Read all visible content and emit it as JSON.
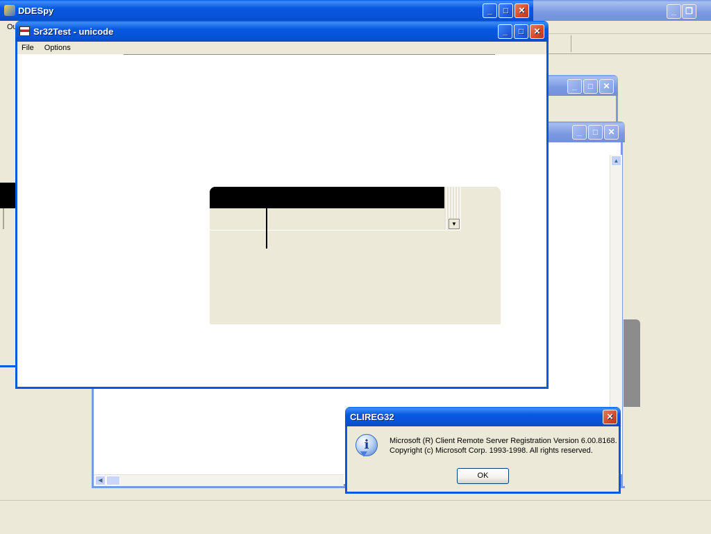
{
  "ddespy": {
    "title": "DDESpy",
    "menu_stub": "Ou"
  },
  "bg_window_right": {
    "title": ""
  },
  "sr32": {
    "title": "Sr32Test - unicode",
    "menu": [
      "File",
      "Options"
    ]
  },
  "mid_window_1": {
    "title": ""
  },
  "mid_window_2": {
    "title": ""
  },
  "clireg": {
    "title": "CLIREG32",
    "message_line1": "Microsoft (R) Client Remote Server Registration Version 6.00.8168.",
    "message_line2": "Copyright (c) Microsoft Corp. 1993-1998. All rights reserved.",
    "ok_label": "OK"
  },
  "icons": {
    "minimize": "_",
    "maximize": "□",
    "restore": "❐",
    "close": "✕",
    "info": "i",
    "scroll_up": "▲",
    "scroll_down": "▼",
    "scroll_left": "◀"
  }
}
